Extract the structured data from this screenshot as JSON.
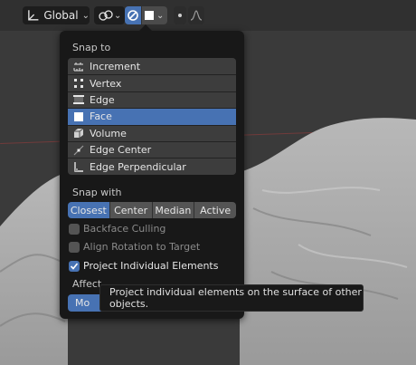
{
  "header": {
    "orientation_label": "Global",
    "snap_icon": "magnet-snap-icon",
    "snap_target_swatch": "#ffffff"
  },
  "snap_to": {
    "label": "Snap to",
    "items": [
      {
        "label": "Increment",
        "icon": "increment-icon"
      },
      {
        "label": "Vertex",
        "icon": "vertex-icon"
      },
      {
        "label": "Edge",
        "icon": "edge-icon"
      },
      {
        "label": "Face",
        "icon": "face-icon"
      },
      {
        "label": "Volume",
        "icon": "volume-icon"
      },
      {
        "label": "Edge Center",
        "icon": "edge-center-icon"
      },
      {
        "label": "Edge Perpendicular",
        "icon": "edge-perpendicular-icon"
      }
    ],
    "selected": "Face"
  },
  "snap_with": {
    "label": "Snap with",
    "options": [
      "Closest",
      "Center",
      "Median",
      "Active"
    ],
    "selected": "Closest"
  },
  "options": {
    "backface_culling": {
      "label": "Backface Culling",
      "checked": false
    },
    "align_rotation": {
      "label": "Align Rotation to Target",
      "checked": false
    },
    "project_individual": {
      "label": "Project Individual Elements",
      "checked": true
    }
  },
  "affect": {
    "label": "Affect",
    "button_label": "Mo"
  },
  "tooltip": {
    "text": "Project individual elements on the surface of other objects."
  },
  "colors": {
    "accent": "#4772b3",
    "panel": "#181818",
    "item": "#3d3d3d"
  }
}
